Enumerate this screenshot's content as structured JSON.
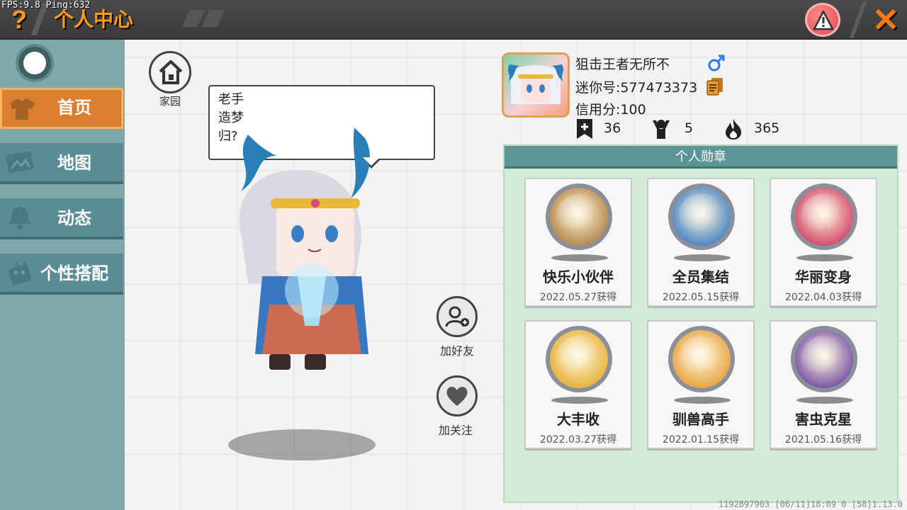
{
  "overlay": {
    "fps": "FPS:9.8  Ping:632"
  },
  "header": {
    "help_glyph": "?",
    "title": "个人中心",
    "close_glyph": "✕",
    "report_icon": "warning-icon",
    "accent": "#ff9a1f"
  },
  "sidebar": {
    "items": [
      {
        "label": "首页",
        "icon": "shirt-icon",
        "active": true
      },
      {
        "label": "地图",
        "icon": "map-icon",
        "active": false
      },
      {
        "label": "动态",
        "icon": "bell-icon",
        "active": false
      },
      {
        "label": "个性搭配",
        "icon": "outfit-icon",
        "active": false
      }
    ]
  },
  "scene": {
    "home_label": "家园",
    "speech": [
      "老手",
      "造梦",
      "归?"
    ],
    "add_friend_label": "加好友",
    "follow_label": "加关注"
  },
  "profile": {
    "name": "狙击王者无所不",
    "mini_id": "迷你号:577473373",
    "credit": "信用分:100",
    "stats": [
      {
        "icon": "bookmark-plus-icon",
        "value": "36"
      },
      {
        "icon": "fans-icon",
        "value": "5"
      },
      {
        "icon": "fire-icon",
        "value": "365"
      }
    ]
  },
  "medals": {
    "header": "个人勋章",
    "items": [
      {
        "name": "快乐小伙伴",
        "date": "2022.05.27获得",
        "color": "#b5894d"
      },
      {
        "name": "全员集结",
        "date": "2022.05.15获得",
        "color": "#4a86c7"
      },
      {
        "name": "华丽变身",
        "date": "2022.04.03获得",
        "color": "#d24a6c"
      },
      {
        "name": "大丰收",
        "date": "2022.03.27获得",
        "color": "#e7b23a"
      },
      {
        "name": "驯兽高手",
        "date": "2022.01.15获得",
        "color": "#e7a442"
      },
      {
        "name": "害虫克星",
        "date": "2021.05.16获得",
        "color": "#7a55a8"
      }
    ]
  },
  "footer": {
    "info": "1192897903    [06/11]18:09 0  [58]1.13.0"
  }
}
